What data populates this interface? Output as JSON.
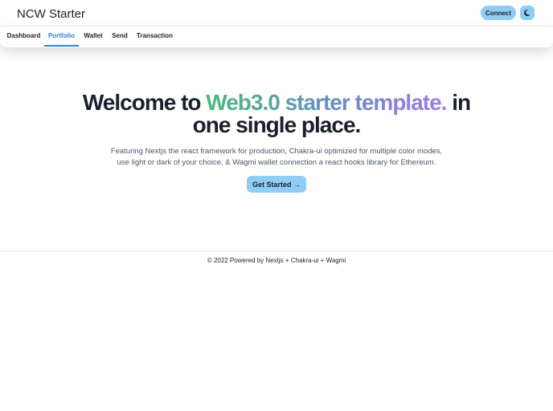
{
  "header": {
    "brand": "NCW Starter",
    "connect_label": "Connect",
    "theme_icon": "moon-icon"
  },
  "tabs": [
    {
      "label": "Dashboard",
      "active": false
    },
    {
      "label": "Portfolio",
      "active": true
    },
    {
      "label": "Wallet",
      "active": false
    },
    {
      "label": "Send",
      "active": false
    },
    {
      "label": "Transaction",
      "active": false
    }
  ],
  "hero": {
    "title_start": "Welcome to ",
    "title_highlight": "Web3.0 starter template.",
    "title_end": " in one single place.",
    "description": "Featuring Nextjs the react framework for production, Chakra-ui optimized for multiple color modes, use light or dark of your choice. & Wagmi wallet connection a react hooks library for Ethereum.",
    "cta_label": "Get Started →"
  },
  "footer": {
    "text": "© 2022 Powered by Nextjs + Chakra-ui + Wagmi"
  },
  "colors": {
    "accent": "#3182ce",
    "button_bg": "#90cdf4",
    "gradient_start": "#48bb78",
    "gradient_end": "#9f7aea"
  }
}
